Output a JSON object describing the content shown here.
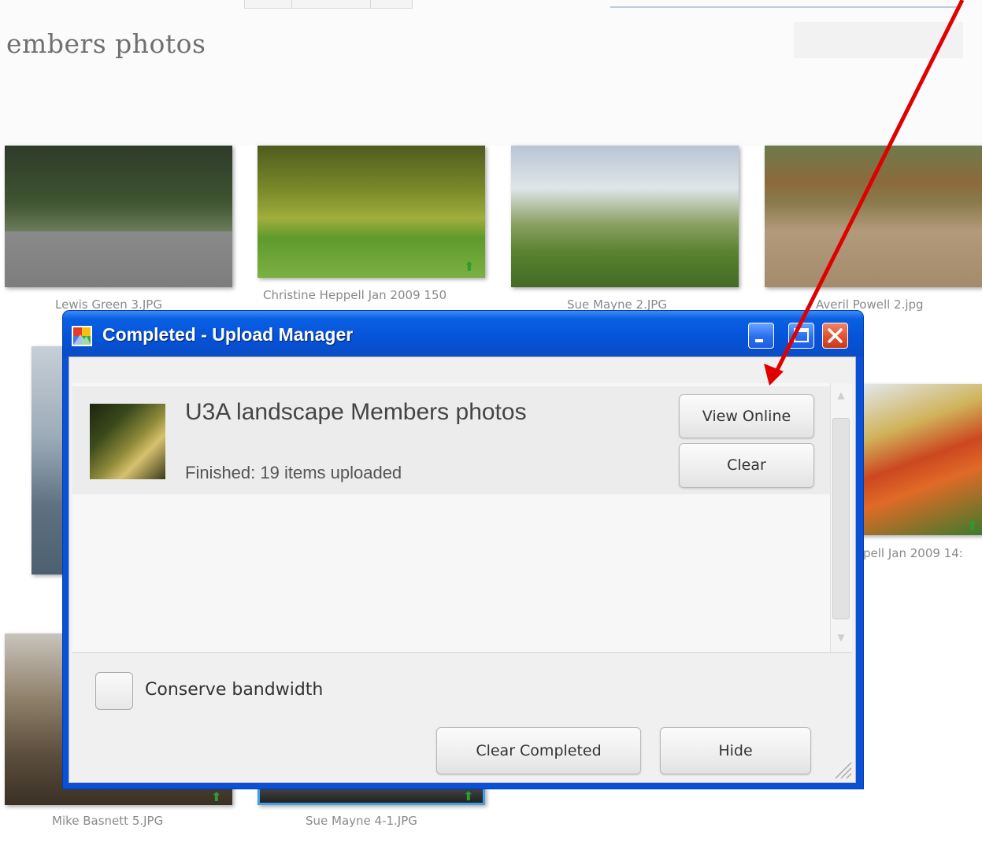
{
  "page": {
    "title": "embers photos"
  },
  "gallery": {
    "captions": [
      "Lewis Green 3.JPG",
      "Christine Heppell Jan 2009 150",
      "Sue Mayne 2.JPG",
      "Averil Powell 2.jpg",
      "pell Jan 2009 14:",
      "Mike Basnett 5.JPG",
      "Sue Mayne 4-1.JPG"
    ]
  },
  "window": {
    "title": "Completed - Upload Manager",
    "controls": {
      "minimize_icon": "minimize-icon",
      "maximize_icon": "maximize-icon",
      "close_icon": "close-icon"
    }
  },
  "upload_item": {
    "album_name": "U3A landscape Members photos",
    "status": "Finished: 19 items uploaded",
    "view_online_label": "View Online",
    "clear_label": "Clear"
  },
  "footer": {
    "conserve_label": "Conserve bandwidth",
    "conserve_checked": false,
    "clear_completed_label": "Clear Completed",
    "hide_label": "Hide"
  },
  "colors": {
    "title_bar": "#0553d8",
    "annotation_arrow": "#e00000",
    "upload_arrow": "#2f9a2f"
  }
}
